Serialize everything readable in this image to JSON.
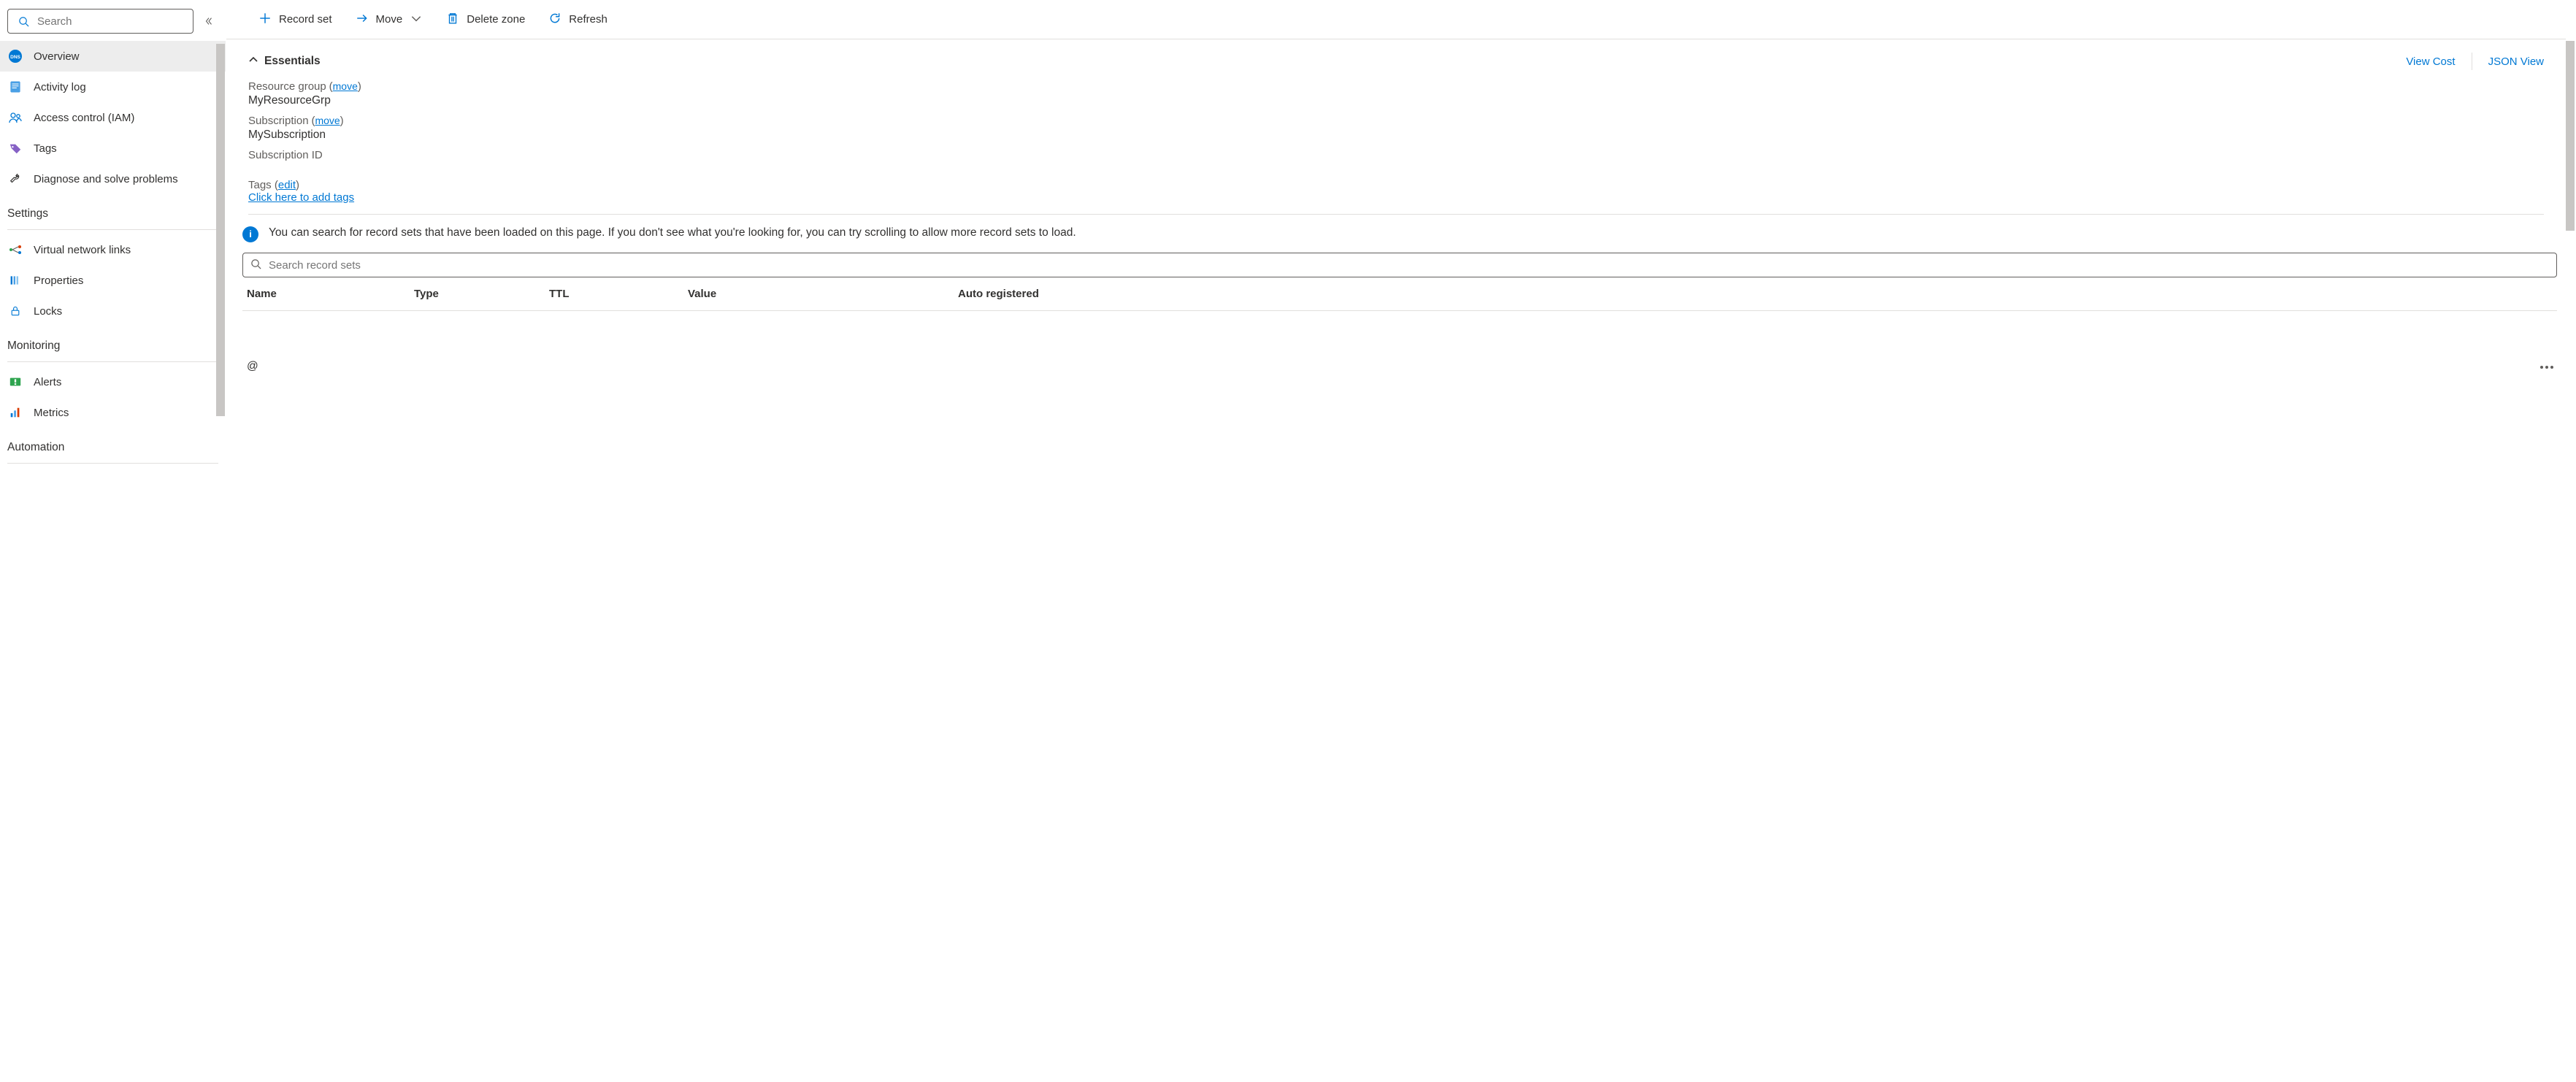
{
  "sidebar": {
    "search_placeholder": "Search",
    "items": [
      {
        "label": "Overview"
      },
      {
        "label": "Activity log"
      },
      {
        "label": "Access control (IAM)"
      },
      {
        "label": "Tags"
      },
      {
        "label": "Diagnose and solve problems"
      }
    ],
    "sections": [
      {
        "title": "Settings",
        "items": [
          {
            "label": "Virtual network links"
          },
          {
            "label": "Properties"
          },
          {
            "label": "Locks"
          }
        ]
      },
      {
        "title": "Monitoring",
        "items": [
          {
            "label": "Alerts"
          },
          {
            "label": "Metrics"
          }
        ]
      },
      {
        "title": "Automation",
        "items": []
      }
    ]
  },
  "toolbar": {
    "record_set": "Record set",
    "move": "Move",
    "delete_zone": "Delete zone",
    "refresh": "Refresh"
  },
  "essentials": {
    "title": "Essentials",
    "view_cost": "View Cost",
    "json_view": "JSON View",
    "resource_group_label": "Resource group",
    "resource_group_move": "move",
    "resource_group_value": "MyResourceGrp",
    "subscription_label": "Subscription",
    "subscription_move": "move",
    "subscription_value": "MySubscription",
    "subscription_id_label": "Subscription ID",
    "subscription_id_value": "",
    "tags_label": "Tags",
    "tags_edit": "edit",
    "tags_link": "Click here to add tags"
  },
  "info": {
    "text": "You can search for record sets that have been loaded on this page. If you don't see what you're looking for, you can try scrolling to allow more record sets to load."
  },
  "record_search": {
    "placeholder": "Search record sets"
  },
  "table": {
    "headers": {
      "name": "Name",
      "type": "Type",
      "ttl": "TTL",
      "value": "Value",
      "auto": "Auto registered"
    },
    "rows": [
      {
        "name": "@",
        "type": "",
        "ttl": "",
        "value": "",
        "auto": ""
      }
    ]
  }
}
